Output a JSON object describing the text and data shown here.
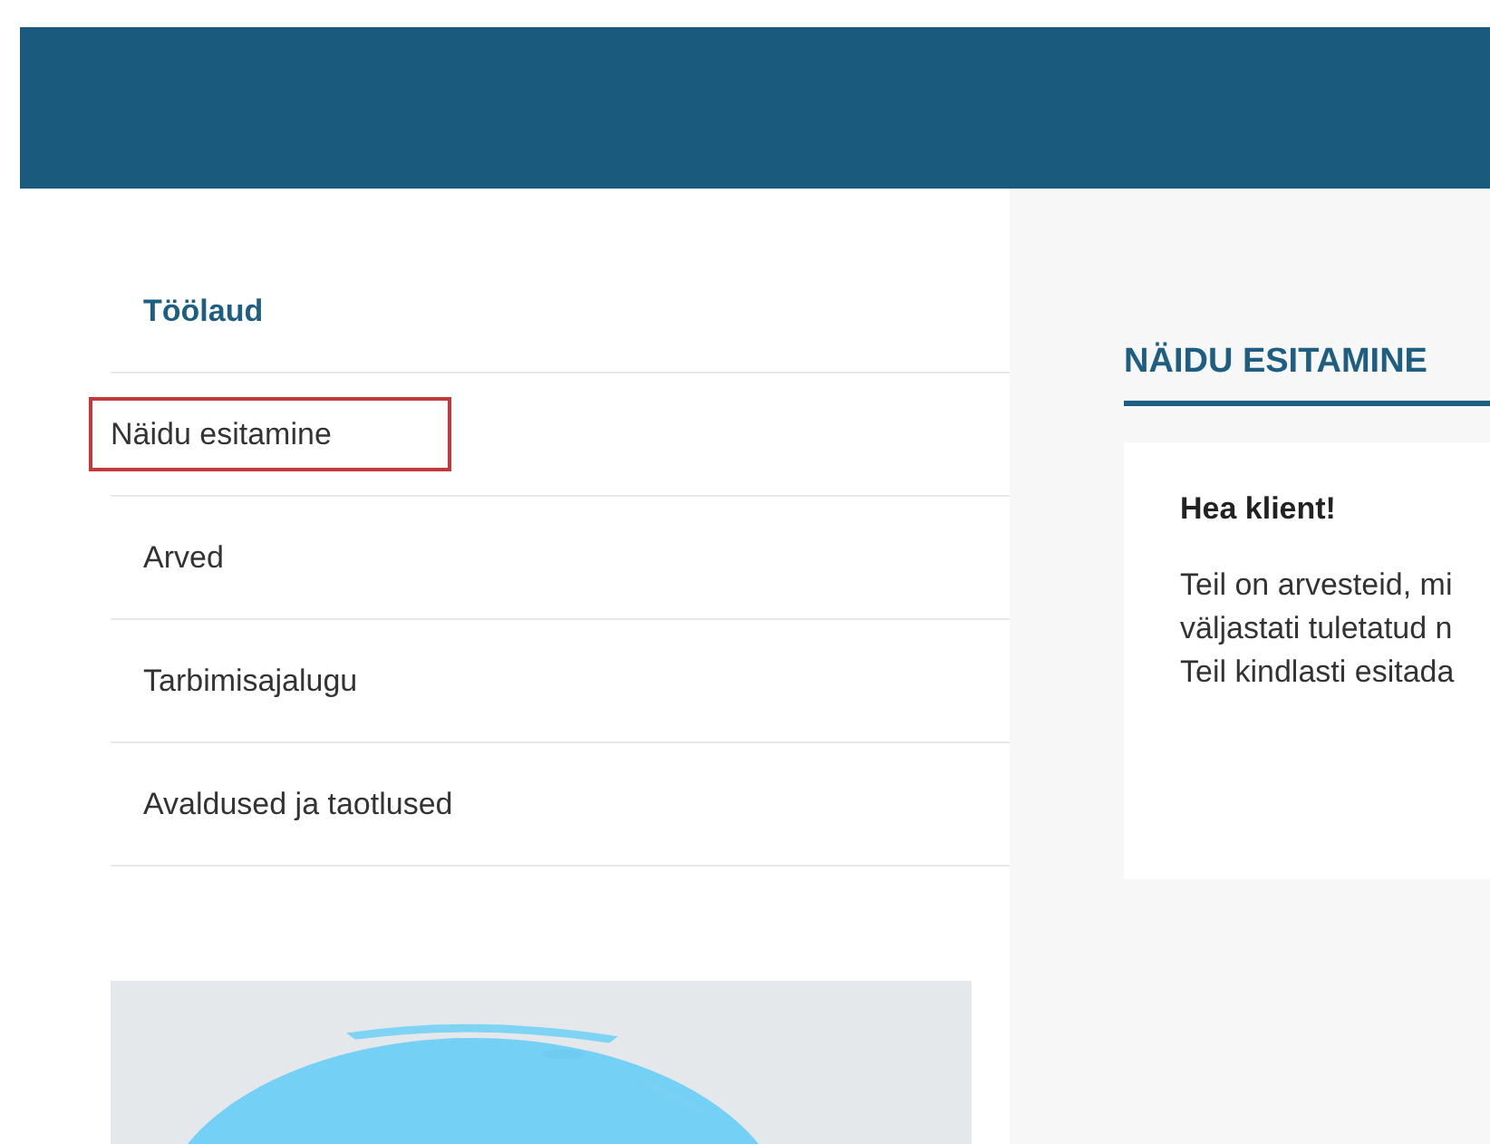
{
  "menu": [
    {
      "label": "Töölaud",
      "kind": "heading",
      "highlighted": false
    },
    {
      "label": "Näidu esitamine",
      "kind": "link",
      "highlighted": true
    },
    {
      "label": "Arved",
      "kind": "link",
      "highlighted": false
    },
    {
      "label": "Tarbimisajalugu",
      "kind": "link",
      "highlighted": false
    },
    {
      "label": "Avaldused ja taotlused",
      "kind": "link",
      "highlighted": false
    }
  ],
  "content": {
    "title": "NÄIDU ESITAMINE",
    "greeting": "Hea klient!",
    "lines": [
      "Teil on arvesteid, mi",
      "väljastati tuletatud n",
      "Teil kindlasti esitada"
    ]
  }
}
